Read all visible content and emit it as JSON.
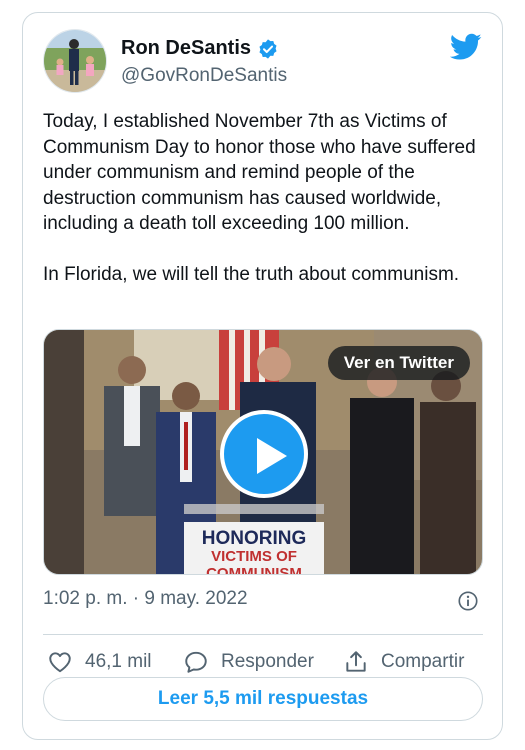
{
  "author": {
    "name": "Ron DeSantis",
    "handle": "@GovRonDeSantis",
    "verified": true
  },
  "tweet": {
    "paragraphs": [
      "Today, I established November 7th as Victims of Communism Day to honor those who have suffered under communism and remind people of the destruction communism has caused worldwide, including a death toll exceeding 100 million.",
      "In Florida, we will tell the truth about communism."
    ]
  },
  "media": {
    "view_on_label": "Ver en Twitter",
    "podium_sign": [
      "HONORING",
      "VICTIMS OF",
      "COMMUNISM"
    ]
  },
  "meta": {
    "timestamp": "1:02 p. m. · 9 may. 2022"
  },
  "actions": {
    "likes": "46,1 mil",
    "reply_label": "Responder",
    "share_label": "Compartir"
  },
  "read_replies_label": "Leer 5,5 mil respuestas",
  "colors": {
    "accent": "#1d9bf0",
    "text_primary": "#0f1419",
    "text_secondary": "#536471",
    "border": "#cfd9de"
  },
  "icons": [
    "verified-badge-icon",
    "twitter-bird-icon",
    "play-icon",
    "info-icon",
    "heart-icon",
    "reply-bubble-icon",
    "share-icon"
  ]
}
